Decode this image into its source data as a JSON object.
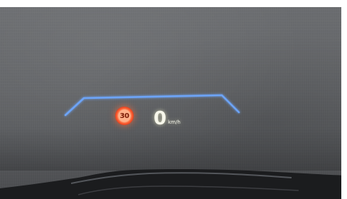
{
  "hud": {
    "speed_limit": "30",
    "speed": "0",
    "speed_unit": "km/h"
  },
  "colors": {
    "lane_line": "#6ea8ff",
    "speed_limit_sign": "#ff5a2e",
    "speed_text": "#f4f4e6"
  }
}
